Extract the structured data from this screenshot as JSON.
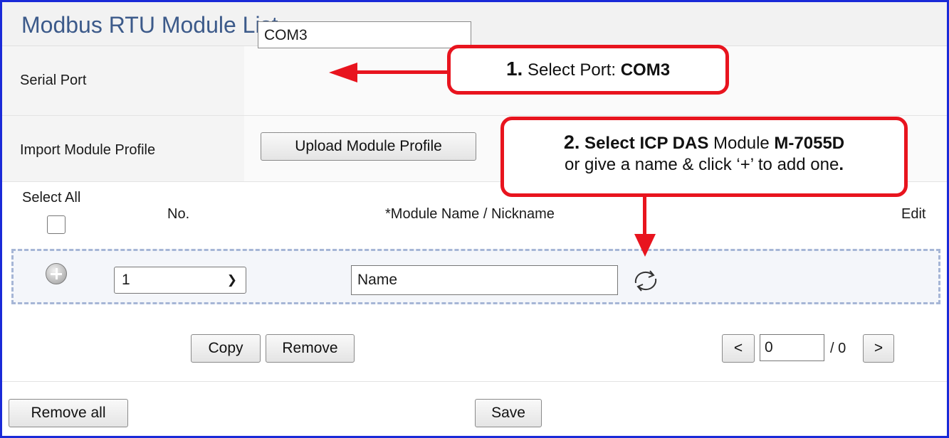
{
  "page": {
    "title": "Modbus RTU Module List"
  },
  "serial_port": {
    "label": "Serial Port",
    "value": "COM3"
  },
  "import": {
    "label": "Import Module Profile",
    "button": "Upload Module Profile"
  },
  "table": {
    "select_all": "Select All",
    "col_no": "No.",
    "col_name": "*Module Name / Nickname",
    "col_edit": "Edit"
  },
  "module_row": {
    "no_value": "1",
    "name_value": "Name"
  },
  "actions": {
    "copy": "Copy",
    "remove": "Remove",
    "remove_all": "Remove all",
    "save": "Save"
  },
  "pager": {
    "prev": "<",
    "current": "0",
    "total": "/ 0",
    "next": ">"
  },
  "callouts": {
    "c1": {
      "num": "1.",
      "text": " Select Port: ",
      "bold": "COM3"
    },
    "c2": {
      "num": "2.",
      "b1": " Select ICP DAS",
      "t1": " Module ",
      "b2": "M-7055D",
      "line2": "or give a name & click ‘+’ to add one",
      "period": "."
    }
  },
  "icons": {
    "add": "plus-circle-icon",
    "refresh": "refresh-icon",
    "dropdown": "chevron-down-icon"
  },
  "colors": {
    "accent_red": "#e8141e",
    "title_blue": "#3c5a8a",
    "frame_blue": "#1a2ad8",
    "row_dash": "#a6b6d6"
  }
}
